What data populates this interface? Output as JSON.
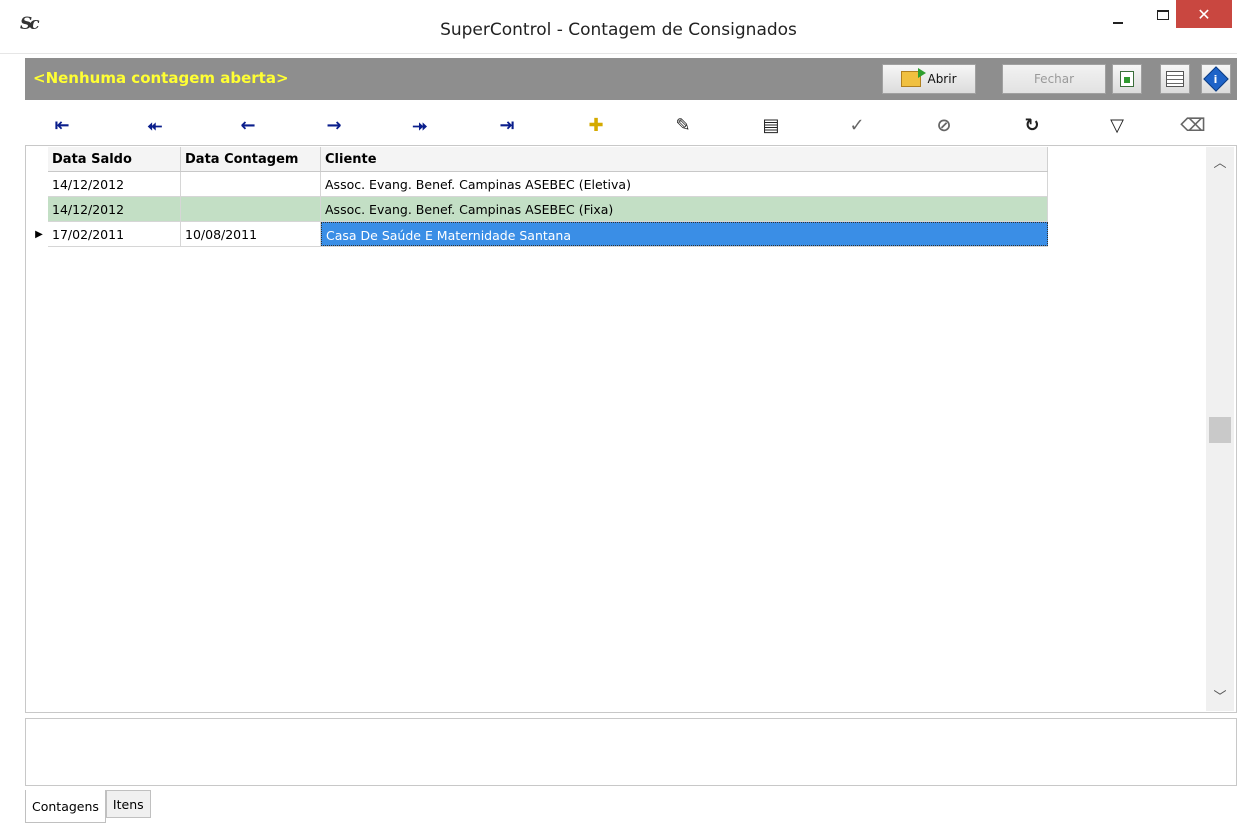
{
  "window": {
    "title": "SuperControl - Contagem de Consignados",
    "app_icon": "Sc",
    "close_glyph": "✕"
  },
  "header": {
    "status_text": "<Nenhuma contagem aberta>",
    "open_label": "Abrir",
    "close_label": "Fechar"
  },
  "navigator": {
    "buttons": [
      {
        "icon": "first-record-icon",
        "glyph": "⇤"
      },
      {
        "icon": "prior-page-icon",
        "glyph": "⯬"
      },
      {
        "icon": "prior-record-icon",
        "glyph": "←"
      },
      {
        "icon": "next-record-icon",
        "glyph": "→"
      },
      {
        "icon": "next-page-icon",
        "glyph": "⯮"
      },
      {
        "icon": "last-record-icon",
        "glyph": "⇥"
      },
      {
        "icon": "insert-icon",
        "glyph": "✚"
      },
      {
        "icon": "edit-icon",
        "glyph": "✎"
      },
      {
        "icon": "delete-icon",
        "glyph": "▤"
      },
      {
        "icon": "post-icon",
        "glyph": "✓"
      },
      {
        "icon": "cancel-icon",
        "glyph": "⊘"
      },
      {
        "icon": "refresh-icon",
        "glyph": "↻"
      },
      {
        "icon": "filter-icon",
        "glyph": "▽"
      },
      {
        "icon": "clear-filter-icon",
        "glyph": "⌫"
      }
    ]
  },
  "grid": {
    "columns": [
      "Data Saldo",
      "Data Contagem",
      "Cliente"
    ],
    "rows": [
      {
        "data_saldo": "14/12/2012",
        "data_contagem": "",
        "cliente": "Assoc. Evang. Benef. Campinas ASEBEC (Eletiva)"
      },
      {
        "data_saldo": "14/12/2012",
        "data_contagem": "",
        "cliente": "Assoc. Evang. Benef. Campinas ASEBEC (Fixa)"
      },
      {
        "data_saldo": "17/02/2011",
        "data_contagem": "10/08/2011",
        "cliente": "Casa De Saúde E Maternidade Santana"
      }
    ],
    "current_row_glyph": "▶"
  },
  "tabs": [
    "Contagens",
    "Itens"
  ],
  "colors": {
    "header_bg": "#8e8e8e",
    "status_text": "#ffff33",
    "green_row": "#c3dfc5",
    "selected_cell": "#3a8ee6",
    "close_button": "#c94740"
  }
}
